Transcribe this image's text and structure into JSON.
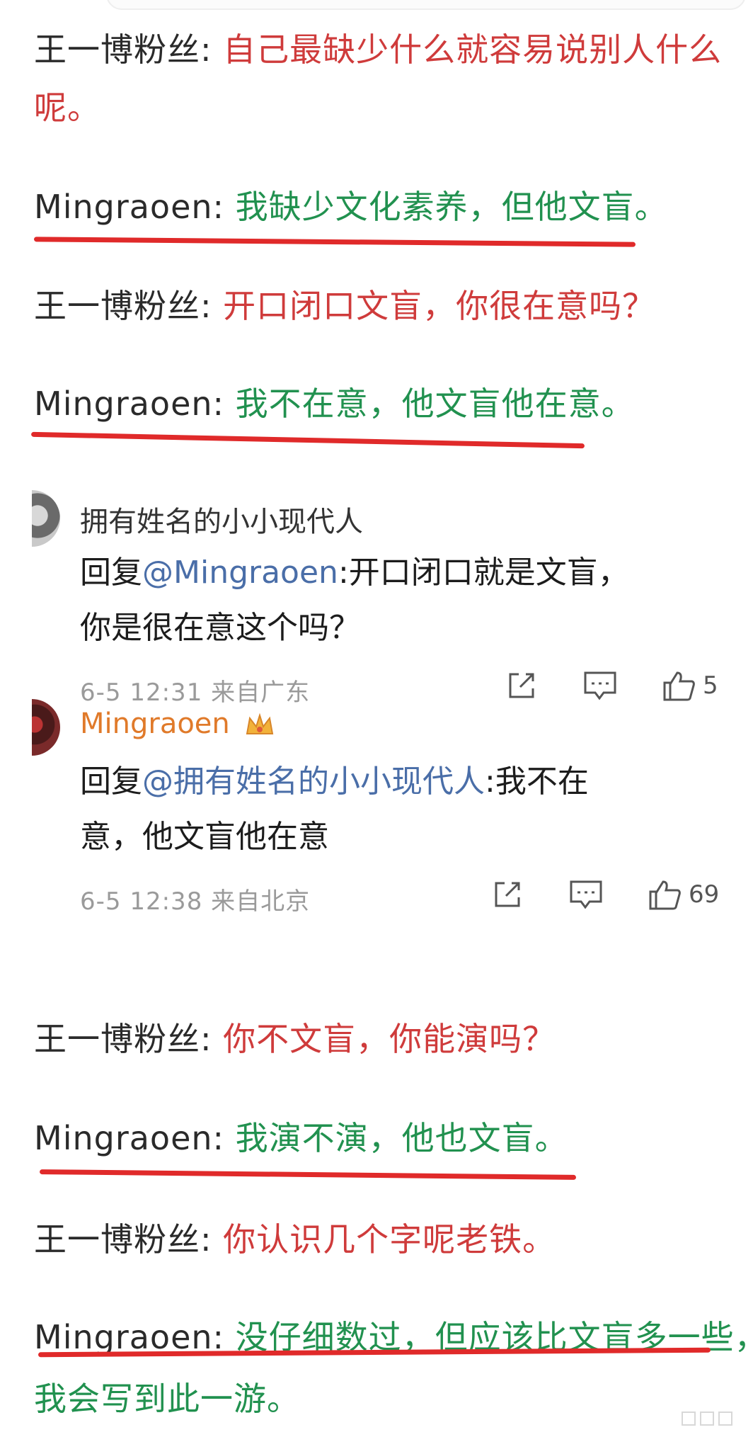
{
  "dialogue": [
    {
      "speaker": "王一博粉丝",
      "colon": ":",
      "text": "自己最缺少什么就容易说别人什么",
      "text_cont": "呢。"
    },
    {
      "speaker": "Mingraoen",
      "colon": ":",
      "text": "我缺少文化素养，但他文盲。"
    },
    {
      "speaker": "王一博粉丝",
      "colon": ":",
      "text": "开口闭口文盲，你很在意吗？"
    },
    {
      "speaker": "Mingraoen",
      "colon": ":",
      "text": "我不在意，他文盲他在意。"
    },
    {
      "speaker": "王一博粉丝",
      "colon": ":",
      "text": "你不文盲，你能演吗？"
    },
    {
      "speaker": "Mingraoen",
      "colon": ":",
      "text": "我演不演，他也文盲。"
    },
    {
      "speaker": "王一博粉丝",
      "colon": ":",
      "text": "你认识几个字呢老铁。"
    },
    {
      "speaker": "Mingraoen",
      "colon": ":",
      "text": "没仔细数过，但应该比文盲多一些，",
      "text_cont": "我会写到此一游。"
    }
  ],
  "screenshot": {
    "comments": [
      {
        "username": "拥有姓名的小小现代人",
        "reply_prefix": "回复",
        "mention": "@Mingraoen",
        "text_a": ":开口闭口就是文盲，",
        "text_b": "你是很在意这个吗？",
        "date": "6-5 12:31",
        "location": "来自广东",
        "likes": "5"
      },
      {
        "username": "Mingraoen",
        "reply_prefix": "回复",
        "mention": "@拥有姓名的小小现代人",
        "text_a": ":我不在",
        "text_b": "意，他文盲他在意",
        "date": "6-5 12:38",
        "location": "来自北京",
        "likes": "69"
      }
    ]
  },
  "colors": {
    "fan_text": "#cf3b3b",
    "mingraoen_text": "#21914f",
    "underline": "#e02a2a",
    "mention": "#4a6ea8",
    "vip_name": "#e07a2a"
  },
  "icons": [
    "share-icon",
    "comment-icon",
    "like-icon",
    "crown-icon"
  ]
}
